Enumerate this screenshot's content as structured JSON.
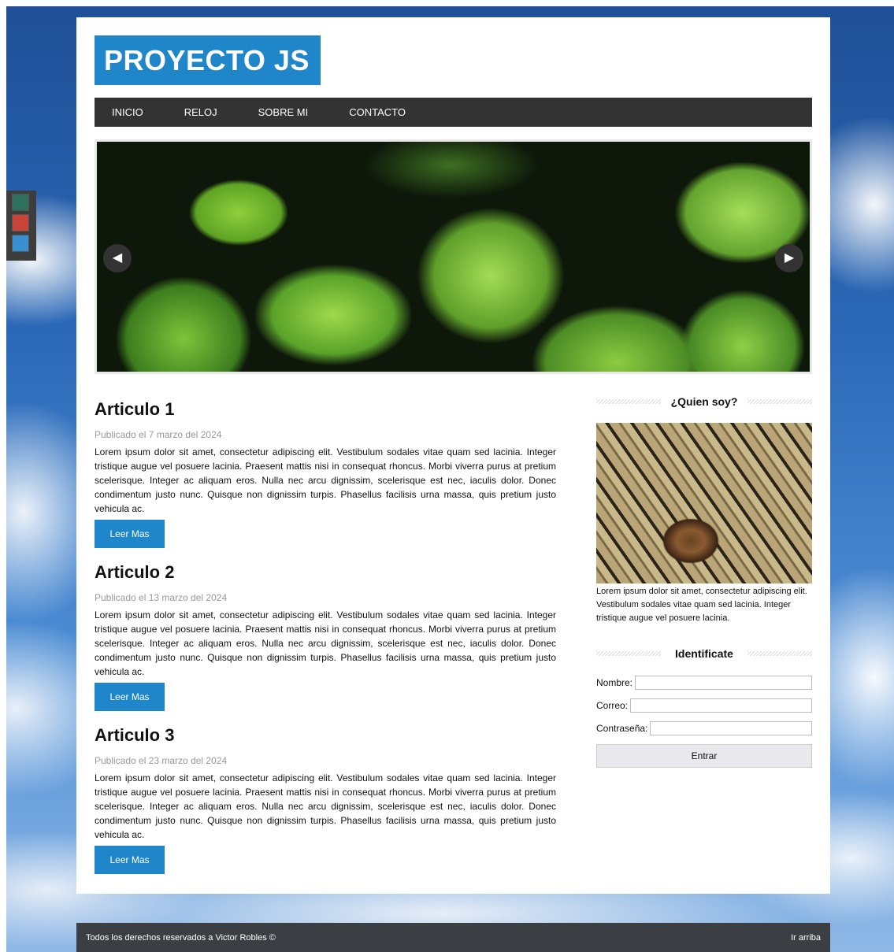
{
  "logo": "PROYECTO JS",
  "nav": [
    "INICIO",
    "RELOJ",
    "SOBRE MI",
    "CONTACTO"
  ],
  "slider": {
    "prev_icon": "◀",
    "next_icon": "▶"
  },
  "articles": [
    {
      "title": "Articulo 1",
      "date": "Publicado el 7 marzo del 2024",
      "body": "Lorem ipsum dolor sit amet, consectetur adipiscing elit. Vestibulum sodales vitae quam sed lacinia. Integer tristique augue vel posuere lacinia. Praesent mattis nisi in consequat rhoncus. Morbi viverra purus at pretium scelerisque. Integer ac aliquam eros. Nulla nec arcu dignissim, scelerisque est nec, iaculis dolor. Donec condimentum justo nunc. Quisque non dignissim turpis. Phasellus facilisis urna massa, quis pretium justo vehicula ac.",
      "button": "Leer Mas"
    },
    {
      "title": "Articulo 2",
      "date": "Publicado el 13 marzo del 2024",
      "body": "Lorem ipsum dolor sit amet, consectetur adipiscing elit. Vestibulum sodales vitae quam sed lacinia. Integer tristique augue vel posuere lacinia. Praesent mattis nisi in consequat rhoncus. Morbi viverra purus at pretium scelerisque. Integer ac aliquam eros. Nulla nec arcu dignissim, scelerisque est nec, iaculis dolor. Donec condimentum justo nunc. Quisque non dignissim turpis. Phasellus facilisis urna massa, quis pretium justo vehicula ac.",
      "button": "Leer Mas"
    },
    {
      "title": "Articulo 3",
      "date": "Publicado el 23 marzo del 2024",
      "body": "Lorem ipsum dolor sit amet, consectetur adipiscing elit. Vestibulum sodales vitae quam sed lacinia. Integer tristique augue vel posuere lacinia. Praesent mattis nisi in consequat rhoncus. Morbi viverra purus at pretium scelerisque. Integer ac aliquam eros. Nulla nec arcu dignissim, scelerisque est nec, iaculis dolor. Donec condimentum justo nunc. Quisque non dignissim turpis. Phasellus facilisis urna massa, quis pretium justo vehicula ac.",
      "button": "Leer Mas"
    }
  ],
  "aside": {
    "about_title": "¿Quien soy?",
    "about_text": "Lorem ipsum dolor sit amet, consectetur adipiscing elit. Vestibulum sodales vitae quam sed lacinia. Integer tristique augue vel posuere lacinia.",
    "form_title": "Identificate",
    "fields": [
      {
        "label": "Nombre:",
        "value": ""
      },
      {
        "label": "Correo:",
        "value": ""
      },
      {
        "label": "Contraseña:",
        "value": ""
      }
    ],
    "submit": "Entrar"
  },
  "footer": {
    "copyright": "Todos los derechos reservados a Victor Robles ©",
    "top_link": "Ir arriba"
  },
  "themes": {
    "colors": [
      "#2f6f5e",
      "#c9453a",
      "#3a8fd0"
    ]
  },
  "colors": {
    "accent": "#1f86c9",
    "nav_bg": "#333333",
    "footer_bg": "#3b3f44"
  }
}
